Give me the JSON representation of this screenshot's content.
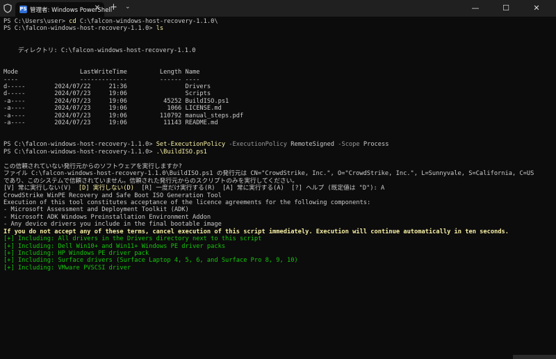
{
  "window": {
    "tab_title": "管理者: Windows PowerShell",
    "tab_icon": "PS",
    "close_tab": "✕",
    "new_tab": "+",
    "dropdown": "⌄",
    "minimize": "—",
    "maximize": "☐",
    "close": "✕"
  },
  "terminal": {
    "l1_prompt": "PS C:\\Users\\user> ",
    "l1_cmd": "cd",
    "l1_arg": " C:\\falcon-windows-host-recovery-1.1.0\\",
    "l2_prompt": "PS C:\\falcon-windows-host-recovery-1.1.0> ",
    "l2_cmd": "ls",
    "dir_label": "    ディレクトリ: C:\\falcon-windows-host-recovery-1.1.0",
    "header": "Mode                 LastWriteTime         Length Name",
    "underline": "----                 -------------         ------ ----",
    "rows": [
      "d-----        2024/07/22     21:36                Drivers",
      "d-----        2024/07/23     19:06                Scripts",
      "-a----        2024/07/23     19:06          45252 BuildISO.ps1",
      "-a----        2024/07/23     19:06           1066 LICENSE.md",
      "-a----        2024/07/23     19:06         110792 manual_steps.pdf",
      "-a----        2024/07/23     19:06          11143 README.md"
    ],
    "l3_prompt": "PS C:\\falcon-windows-host-recovery-1.1.0> ",
    "l3_cmd": "Set-ExecutionPolicy",
    "l3_p1": " -ExecutionPolicy",
    "l3_v1": " RemoteSigned",
    "l3_p2": " -Scope",
    "l3_v2": " Process",
    "l4_prompt": "PS C:\\falcon-windows-host-recovery-1.1.0> ",
    "l4_cmd": ".\\BuildISO.ps1",
    "warn1": "この信頼されていない発行元からのソフトウェアを実行しますか?",
    "warn2": "ファイル C:\\falcon-windows-host-recovery-1.1.0\\BuildISO.ps1 の発行元は CN=\"CrowdStrike, Inc.\", O=\"CrowdStrike, Inc.\", L=Sunnyvale, S=California, C=US",
    "warn3": "であり、このシステムで信頼されていません。信頼された発行元からのスクリプトのみを実行してください。",
    "choice_v": "[V] 常に実行しない(V)  ",
    "choice_d": "[D] 実行しない(D)",
    "choice_rest": "  [R] 一度だけ実行する(R)  [A] 常に実行する(A)  [?] ヘルプ (既定値は \"D\"): A",
    "o1": "CrowdStrike WinPE Recovery and Safe Boot ISO Generation Tool",
    "o2": "Execution of this tool constitutes acceptance of the licence agreements for the following components:",
    "o3": "- Microsoft Assessment and Deployment Toolkit (ADK)",
    "o4": "- Microsoft ADK Windows Preinstallation Environment Addon",
    "o5": "- Any device drivers you include in the final bootable image",
    "o6": "If you do not accept any of these terms, cancel execution of this script immediately. Execution will continue automatically in ten seconds.",
    "inc": [
      "[+] Including: All drivers in the Drivers directory next to this script",
      "[+] Including: Dell Win10+ and Win11+ Windows PE driver packs",
      "[+] Including: HP Windows PE driver pack",
      "[+] Including: Surface drivers (Surface Laptop 4, 5, 6, and Surface Pro 8, 9, 10)",
      "[+] Including: VMware PVSCSI driver"
    ]
  },
  "colors": {
    "background": "#0c0c0c",
    "titlebar": "#202020",
    "command": "#f9f1a5",
    "parameter": "#9a9a9a",
    "success": "#16c60c"
  }
}
